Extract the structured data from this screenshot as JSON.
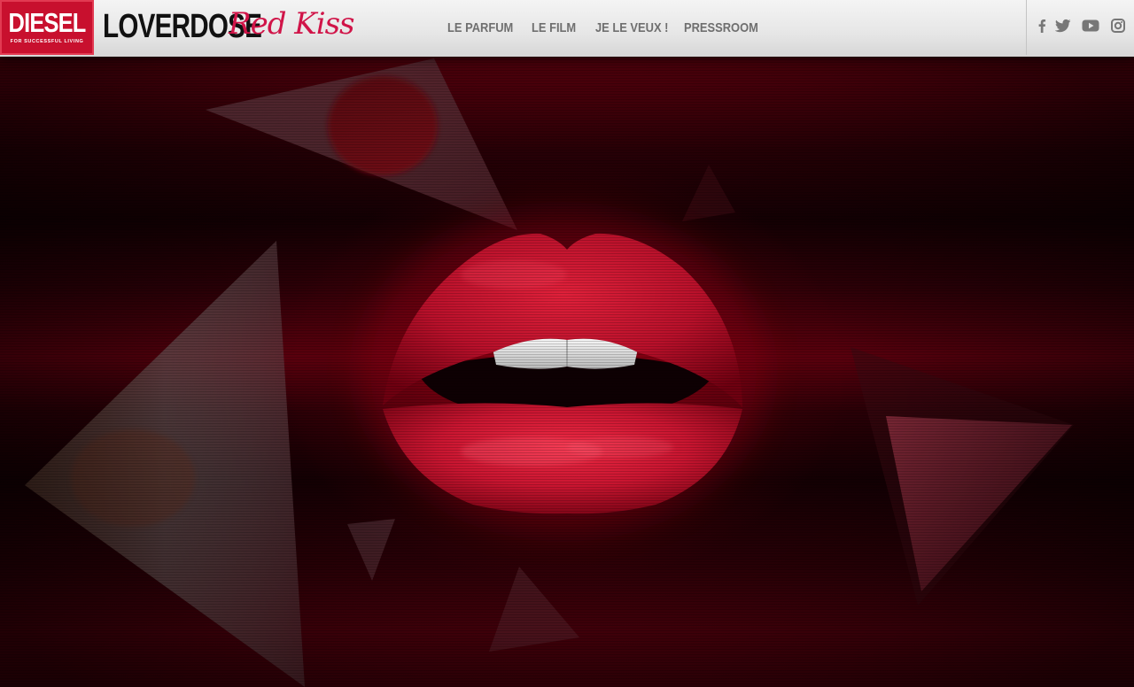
{
  "header": {
    "brand_logo": "DIESEL",
    "brand_tagline": "FOR SUCCESSFUL LIVING",
    "product_name": "LOVERDOSE",
    "product_script": "Red Kiss"
  },
  "nav": {
    "items": [
      {
        "label": "LE PARFUM"
      },
      {
        "label": "LE FILM"
      },
      {
        "label": "JE LE VEUX !"
      },
      {
        "label": "PRESSROOM"
      }
    ]
  },
  "social": {
    "icons": [
      "facebook-icon",
      "twitter-icon",
      "youtube-icon",
      "instagram-icon"
    ]
  },
  "colors": {
    "brand_red": "#c8102e",
    "script_pink": "#d01448",
    "nav_gray": "#6f6f6f",
    "background_red": "#5c000d"
  }
}
